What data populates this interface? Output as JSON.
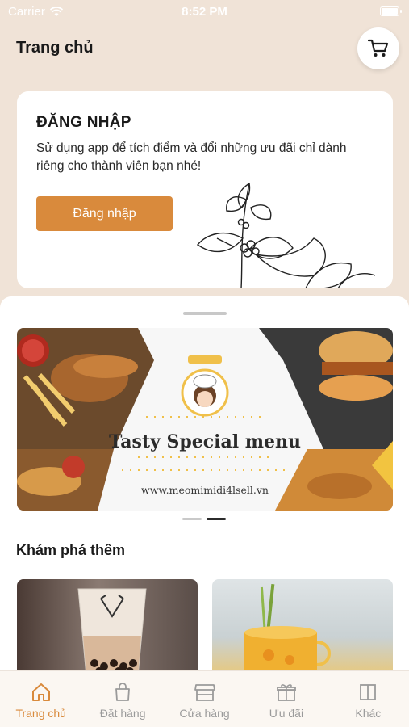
{
  "status_bar": {
    "carrier": "Carrier",
    "time": "8:52 PM"
  },
  "header": {
    "title": "Trang chủ",
    "cart_icon": "cart-icon"
  },
  "login_card": {
    "title": "ĐĂNG NHẬP",
    "description": "Sử dụng app để tích điểm và đổi những ưu đãi chỉ dành riêng cho thành viên bạn nhé!",
    "button_label": "Đăng nhập"
  },
  "banner": {
    "title": "Tasty Special menu",
    "url": "www.meomimidi4lsell.vn",
    "pager": {
      "count": 2,
      "active_index": 1
    }
  },
  "explore": {
    "title": "Khám phá thêm"
  },
  "tab_bar": {
    "items": [
      {
        "label": "Trang chủ",
        "icon": "home-icon",
        "active": true
      },
      {
        "label": "Đặt hàng",
        "icon": "shopping-bag-icon",
        "active": false
      },
      {
        "label": "Cửa hàng",
        "icon": "store-icon",
        "active": false
      },
      {
        "label": "Ưu đãi",
        "icon": "gift-icon",
        "active": false
      },
      {
        "label": "Khác",
        "icon": "more-panel-icon",
        "active": false
      }
    ]
  },
  "colors": {
    "accent": "#d98a3c",
    "background": "#f0e3d7",
    "inactive": "#9a9a9a"
  }
}
